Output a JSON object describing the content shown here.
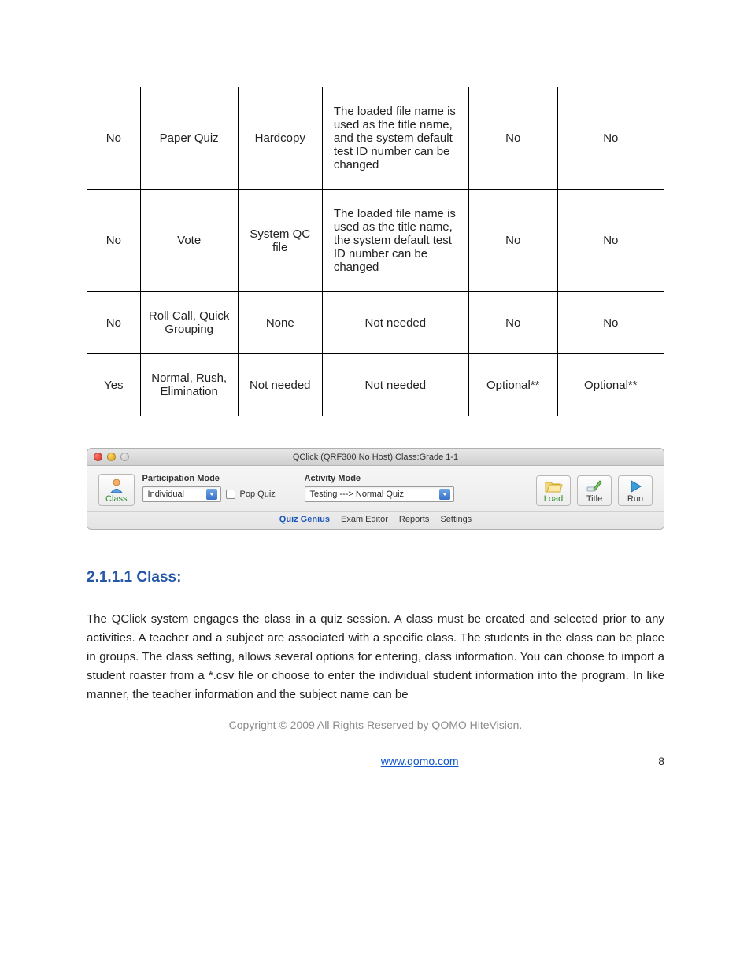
{
  "table": {
    "rows": [
      {
        "c0": "No",
        "c1": "Paper Quiz",
        "c2": "Hardcopy",
        "c3": "The loaded file name is used as the title name, and the system default test ID number can be changed",
        "c4": "No",
        "c5": "No"
      },
      {
        "c0": "No",
        "c1": "Vote",
        "c2": "System QC file",
        "c3": "The loaded file name is used as the title name, the system default test ID number can be changed",
        "c4": "No",
        "c5": "No"
      },
      {
        "c0": "No",
        "c1": "Roll Call, Quick Grouping",
        "c2": "None",
        "c3": "Not needed",
        "c4": "No",
        "c5": "No"
      },
      {
        "c0": "Yes",
        "c1": "Normal, Rush, Elimination",
        "c2": "Not needed",
        "c3": "Not needed",
        "c4": "Optional**",
        "c5": "Optional**"
      }
    ]
  },
  "app": {
    "window_title": "QClick (QRF300 No Host) Class:Grade 1-1",
    "class_btn": "Class",
    "participation_label": "Participation Mode",
    "participation_value": "Individual",
    "popquiz_label": "Pop Quiz",
    "activity_label": "Activity Mode",
    "activity_value": "Testing ---> Normal Quiz",
    "load_btn": "Load",
    "title_btn": "Title",
    "run_btn": "Run",
    "tabs": {
      "quiz_genius": "Quiz Genius",
      "exam_editor": "Exam Editor",
      "reports": "Reports",
      "settings": "Settings"
    }
  },
  "heading": "2.1.1.1 Class:",
  "paragraph": "The QClick system engages the class in a quiz session. A class must be created and selected prior to any activities. A teacher and a subject are associated with a specific class. The students in the class can be place in groups. The class setting, allows several options for entering, class information. You can choose to import a student roaster from a *.csv file or choose to enter the individual student information into the program. In like manner, the teacher information and the subject name can be",
  "copyright": "Copyright © 2009 All Rights Reserved by QOMO HiteVision.",
  "footer_link": "www.qomo.com",
  "page_number": "8"
}
